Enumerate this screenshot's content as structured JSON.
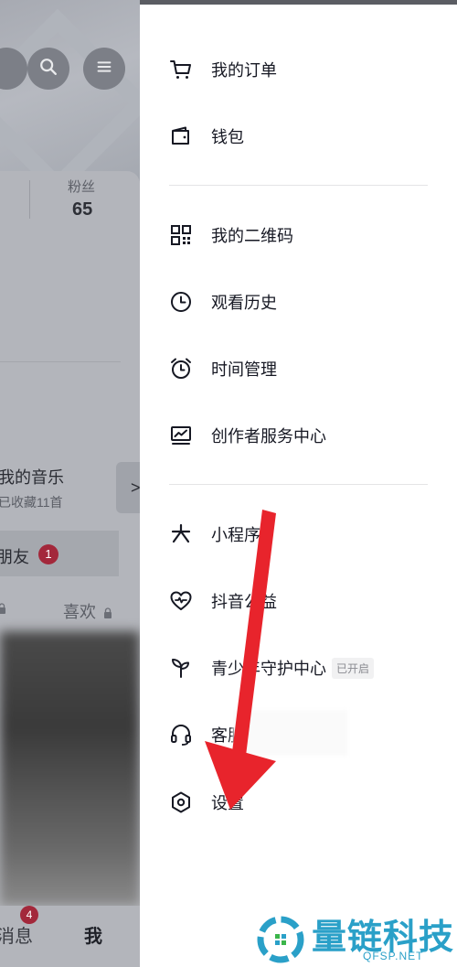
{
  "profile": {
    "fans_label": "粉丝",
    "fans_count": "65",
    "music_title": "我的音乐",
    "music_sub": "已收藏11首",
    "expand_glyph": ">",
    "friends_label": "朋友",
    "friends_badge": "1",
    "like_tab": "喜欢"
  },
  "bottom_nav": {
    "messages_label": "消息",
    "messages_badge": "4",
    "me_label": "我"
  },
  "drawer": {
    "items": [
      {
        "label": "我的订单",
        "icon": "cart-icon"
      },
      {
        "label": "钱包",
        "icon": "wallet-icon"
      },
      {
        "label": "我的二维码",
        "icon": "qr-code-icon"
      },
      {
        "label": "观看历史",
        "icon": "clock-icon"
      },
      {
        "label": "时间管理",
        "icon": "alarm-icon"
      },
      {
        "label": "创作者服务中心",
        "icon": "chart-icon"
      },
      {
        "label": "小程序",
        "icon": "mini-program-icon"
      },
      {
        "label": "抖音公益",
        "icon": "heart-icon"
      },
      {
        "label": "青少年守护中心",
        "icon": "sprout-icon",
        "tag": "已开启"
      },
      {
        "label": "客服",
        "icon": "headset-icon"
      },
      {
        "label": "设置",
        "icon": "settings-icon"
      }
    ]
  },
  "watermark": {
    "text": "量链科技",
    "sub": "QFSP.NET"
  },
  "colors": {
    "arrow": "#e8242c",
    "badge": "#a3283b",
    "watermark": "#2aa0c8"
  }
}
